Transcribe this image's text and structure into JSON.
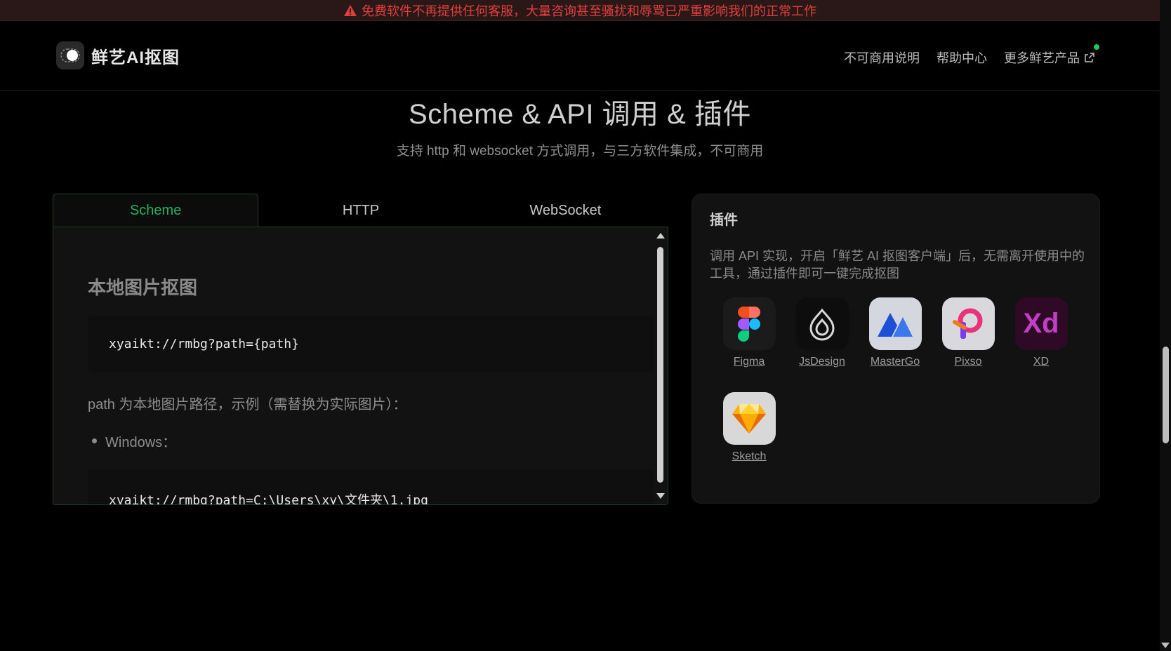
{
  "warning": {
    "text": "免费软件不再提供任何客服，大量咨询甚至骚扰和辱骂已严重影响我们的正常工作",
    "icon": "warning-triangle-icon"
  },
  "header": {
    "logo_text": "鲜艺AI抠图",
    "nav": {
      "noncommercial": "不可商用说明",
      "help": "帮助中心",
      "more": "更多鲜艺产品"
    }
  },
  "section": {
    "title": "Scheme & API 调用 & 插件",
    "subtitle": "支持 http 和 websocket 方式调用，与三方软件集成，不可商用"
  },
  "tabs": {
    "scheme": "Scheme",
    "http": "HTTP",
    "websocket": "WebSocket",
    "active": "Scheme"
  },
  "scheme": {
    "heading": "本地图片抠图",
    "code1": "xyaikt://rmbg?path={path}",
    "desc": "path 为本地图片路径，示例（需替换为实际图片）：",
    "bullet_windows": "Windows：",
    "code2": "xyaikt://rmbg?path=C:\\Users\\xy\\文件夹\\1.jpg"
  },
  "plugins": {
    "title": "插件",
    "desc": "调用 API 实现，开启「鲜艺 AI 抠图客户端」后，无需离开使用中的工具，通过插件即可一键完成抠图",
    "items": [
      {
        "name": "Figma"
      },
      {
        "name": "JsDesign"
      },
      {
        "name": "MasterGo"
      },
      {
        "name": "Pixso"
      },
      {
        "name": "XD"
      },
      {
        "name": "Sketch"
      }
    ]
  },
  "colors": {
    "accent": "#22b35e",
    "warning": "#e0403b",
    "background": "#000000"
  }
}
